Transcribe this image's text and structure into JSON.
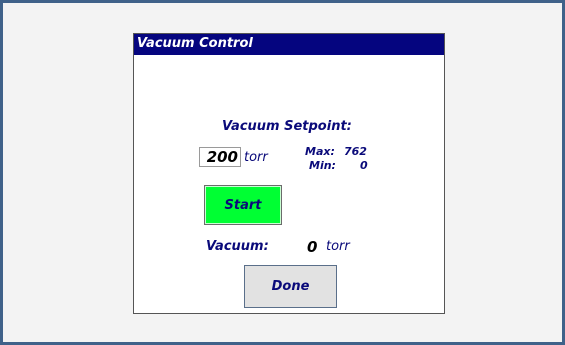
{
  "window": {
    "title": "Vacuum Control"
  },
  "setpoint": {
    "heading": "Vacuum Setpoint:",
    "value": "200",
    "unit": "torr",
    "max_label": "Max:",
    "max_value": "762",
    "min_label": "Min:",
    "min_value": "0"
  },
  "buttons": {
    "start_label": "Start",
    "done_label": "Done"
  },
  "vacuum": {
    "label": "Vacuum:",
    "value": "0",
    "unit": "torr"
  },
  "colors": {
    "title_bar": "#05057f",
    "text_accent": "#0a0a7a",
    "start_button": "#00ff33",
    "frame_border": "#3f6189"
  }
}
